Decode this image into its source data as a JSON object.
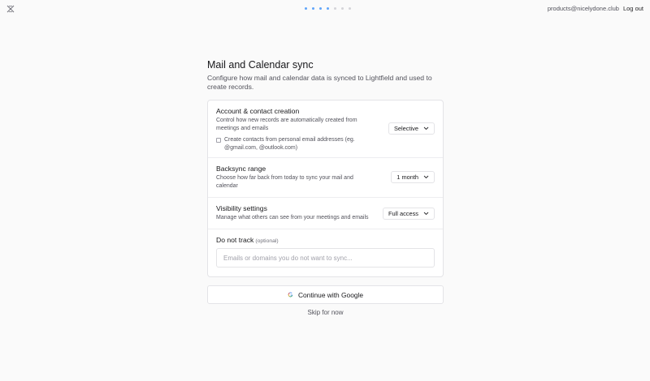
{
  "header": {
    "email": "products@nicelydone.club",
    "logout_label": "Log out",
    "steps_active_color": "#60a5fa",
    "steps_inactive_color": "#d4d4d8",
    "steps_total": 7,
    "steps_completed": 4
  },
  "page": {
    "title": "Mail and Calendar sync",
    "subtitle": "Configure how mail and calendar data is synced to Lightfield and used to create records."
  },
  "sections": {
    "account": {
      "title": "Account & contact creation",
      "description": "Control how new records are automatically created from meetings and emails",
      "select_value": "Selective",
      "checkbox_label": "Create contacts from personal email addresses (eg. @gmail.com, @outlook.com)"
    },
    "backsync": {
      "title": "Backsync range",
      "description": "Choose how far back from today to sync your mail and calendar",
      "select_value": "1 month"
    },
    "visibility": {
      "title": "Visibility settings",
      "description": "Manage what others can see from your meetings and emails",
      "select_value": "Full access"
    },
    "donottrack": {
      "title": "Do not track",
      "optional_label": "(optional)",
      "placeholder": "Emails or domains you do not want to sync..."
    }
  },
  "actions": {
    "google_label": "Continue with Google",
    "skip_label": "Skip for now"
  }
}
